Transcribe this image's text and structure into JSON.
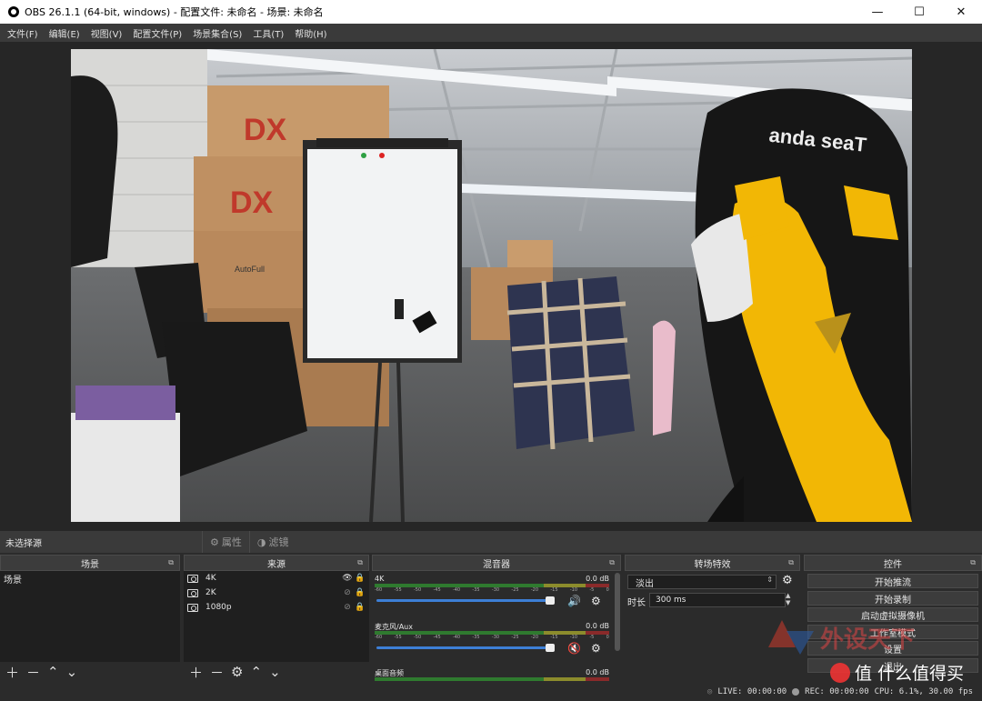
{
  "window": {
    "title": "OBS 26.1.1 (64-bit, windows) - 配置文件: 未命名 - 场景: 未命名",
    "minimize": "—",
    "maximize": "☐",
    "close": "✕"
  },
  "menu": [
    "文件(F)",
    "编辑(E)",
    "视图(V)",
    "配置文件(P)",
    "场景集合(S)",
    "工具(T)",
    "帮助(H)"
  ],
  "preview": {
    "brand1": "DX",
    "brand2": "DX",
    "brand3": "AutoFull",
    "chair": "anda seaT"
  },
  "source_toolbar": {
    "no_source": "未选择源",
    "properties": "属性",
    "filters": "滤镜"
  },
  "docks": {
    "scenes": {
      "title": "场景",
      "items": [
        "场景"
      ]
    },
    "sources": {
      "title": "来源",
      "items": [
        "4K",
        "2K",
        "1080p"
      ]
    },
    "mixer": {
      "title": "混音器",
      "channels": [
        {
          "name": "4K",
          "db": "0.0 dB"
        },
        {
          "name": "麦克风/Aux",
          "db": "0.0 dB"
        },
        {
          "name": "桌面音频",
          "db": "0.0 dB"
        }
      ],
      "scale": [
        "-60",
        "-55",
        "-50",
        "-45",
        "-40",
        "-35",
        "-30",
        "-25",
        "-20",
        "-15",
        "-10",
        "-5",
        "0"
      ]
    },
    "transitions": {
      "title": "转场特效",
      "selected": "淡出",
      "duration_label": "时长",
      "duration": "300 ms"
    },
    "controls": {
      "title": "控件",
      "buttons": [
        "开始推流",
        "开始录制",
        "启动虚拟摄像机",
        "工作室模式",
        "设置",
        "退出"
      ]
    }
  },
  "status": {
    "live": "LIVE: 00:00:00",
    "rec": "REC: 00:00:00",
    "cpu": "CPU: 6.1%, 30.00 fps"
  },
  "watermark": {
    "cn": "外设天下",
    "site": "值 什么值得买"
  }
}
